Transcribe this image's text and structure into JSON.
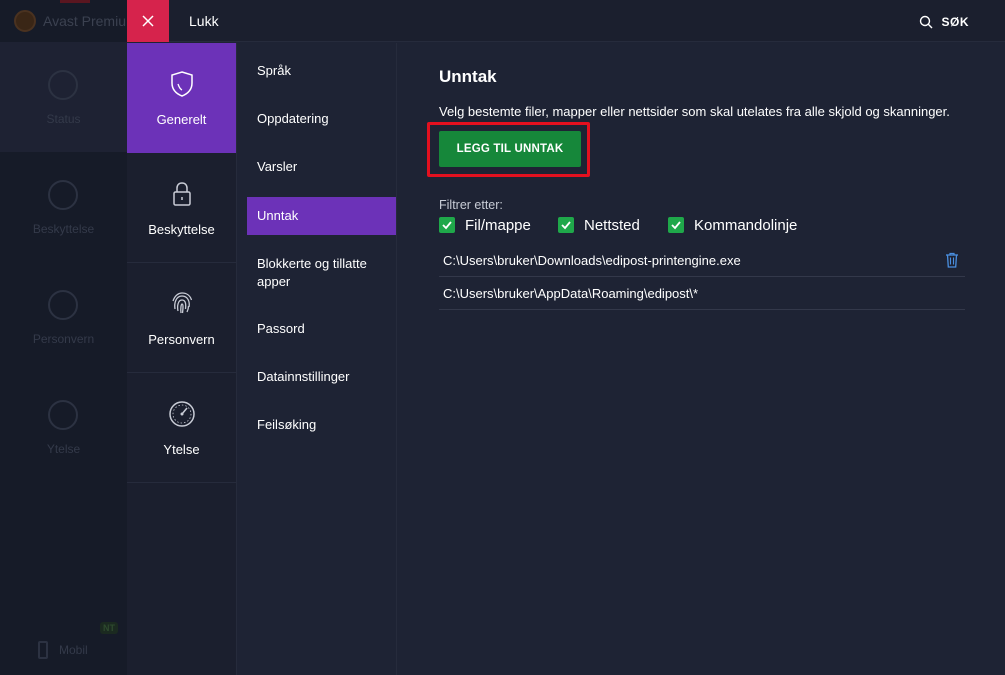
{
  "background_app": {
    "title": "Avast Premiu",
    "nav": [
      {
        "label": "Status"
      },
      {
        "label": "Beskyttelse"
      },
      {
        "label": "Personvern"
      },
      {
        "label": "Ytelse"
      }
    ],
    "mobile_label": "Mobil",
    "nt_badge": "NT"
  },
  "top_bar": {
    "close_label": "Lukk",
    "search_label": "SØK"
  },
  "categories": [
    {
      "label": "Generelt",
      "icon": "shield-icon",
      "active": true
    },
    {
      "label": "Beskyttelse",
      "icon": "lock-icon",
      "active": false
    },
    {
      "label": "Personvern",
      "icon": "fingerprint-icon",
      "active": false
    },
    {
      "label": "Ytelse",
      "icon": "speedometer-icon",
      "active": false
    }
  ],
  "submenu": [
    {
      "label": "Språk"
    },
    {
      "label": "Oppdatering"
    },
    {
      "label": "Varsler"
    },
    {
      "label": "Unntak",
      "active": true
    },
    {
      "label": "Blokkerte og tillatte apper"
    },
    {
      "label": "Passord"
    },
    {
      "label": "Datainnstillinger"
    },
    {
      "label": "Feilsøking"
    }
  ],
  "content": {
    "title": "Unntak",
    "description": "Velg bestemte filer, mapper eller nettsider som skal utelates fra alle skjold og skanninger.",
    "add_button": "LEGG TIL UNNTAK",
    "filter_label": "Filtrer etter:",
    "filters": [
      {
        "label": "Fil/mappe",
        "checked": true
      },
      {
        "label": "Nettsted",
        "checked": true
      },
      {
        "label": "Kommandolinje",
        "checked": true
      }
    ],
    "exceptions": [
      {
        "path": "C:\\Users\\bruker\\Downloads\\edipost-printengine.exe"
      },
      {
        "path": "C:\\Users\\bruker\\AppData\\Roaming\\edipost\\*"
      }
    ]
  },
  "colors": {
    "accent_purple": "#6c32b8",
    "close_red": "#d6234c",
    "button_green": "#16873a",
    "checkbox_green": "#1fa84a",
    "highlight_red": "#e3101f"
  }
}
